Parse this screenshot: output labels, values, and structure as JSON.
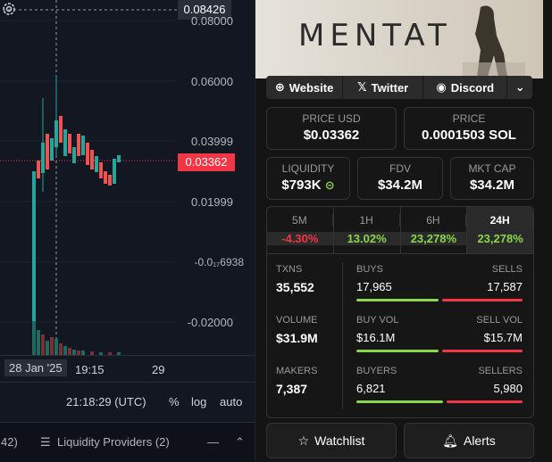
{
  "chart": {
    "top_price": "0.08426",
    "y_labels": [
      "0.08000",
      "0.06000",
      "0.03999",
      "0.01999",
      "-0.0₁₇6938",
      "-0.02000"
    ],
    "current_price": "0.03362",
    "x_labels": {
      "date": "28 Jan '25",
      "time": "19:15",
      "next": "29"
    },
    "clock": "21:18:29 (UTC)",
    "scale_options": [
      "%",
      "log",
      "auto"
    ],
    "tab_count_fragment": "42)",
    "liquidity_tab": "Liquidity Providers (2)"
  },
  "token": {
    "banner_text": "MENTAT",
    "links": [
      "Website",
      "Twitter",
      "Discord"
    ],
    "price_usd": {
      "label": "PRICE USD",
      "value": "$0.03362"
    },
    "price_sol": {
      "label": "PRICE",
      "value": "0.0001503 SOL"
    },
    "liquidity": {
      "label": "LIQUIDITY",
      "value": "$793K"
    },
    "fdv": {
      "label": "FDV",
      "value": "$34.2M"
    },
    "mktcap": {
      "label": "MKT CAP",
      "value": "$34.2M"
    },
    "periods": [
      {
        "label": "5M",
        "value": "-4.30%",
        "color": "#f23645"
      },
      {
        "label": "1H",
        "value": "13.02%",
        "color": "#8bd64a"
      },
      {
        "label": "6H",
        "value": "23,278%",
        "color": "#8bd64a"
      },
      {
        "label": "24H",
        "value": "23,278%",
        "color": "#8bd64a"
      }
    ],
    "txns": {
      "label": "TXNS",
      "value": "35,552"
    },
    "buys": {
      "label": "BUYS",
      "value": "17,965"
    },
    "sells": {
      "label": "SELLS",
      "value": "17,587"
    },
    "volume": {
      "label": "VOLUME",
      "value": "$31.9M"
    },
    "buy_vol": {
      "label": "BUY VOL",
      "value": "$16.1M"
    },
    "sell_vol": {
      "label": "SELL VOL",
      "value": "$15.7M"
    },
    "makers": {
      "label": "MAKERS",
      "value": "7,387"
    },
    "buyers": {
      "label": "BUYERS",
      "value": "6,821"
    },
    "sellers": {
      "label": "SELLERS",
      "value": "5,980"
    },
    "buy_share": 0.505,
    "buy_vol_share": 0.506,
    "buyer_share": 0.533,
    "colors": {
      "green": "#8bd64a",
      "red": "#f23645"
    }
  },
  "actions": {
    "watchlist": "Watchlist",
    "alerts": "Alerts"
  }
}
